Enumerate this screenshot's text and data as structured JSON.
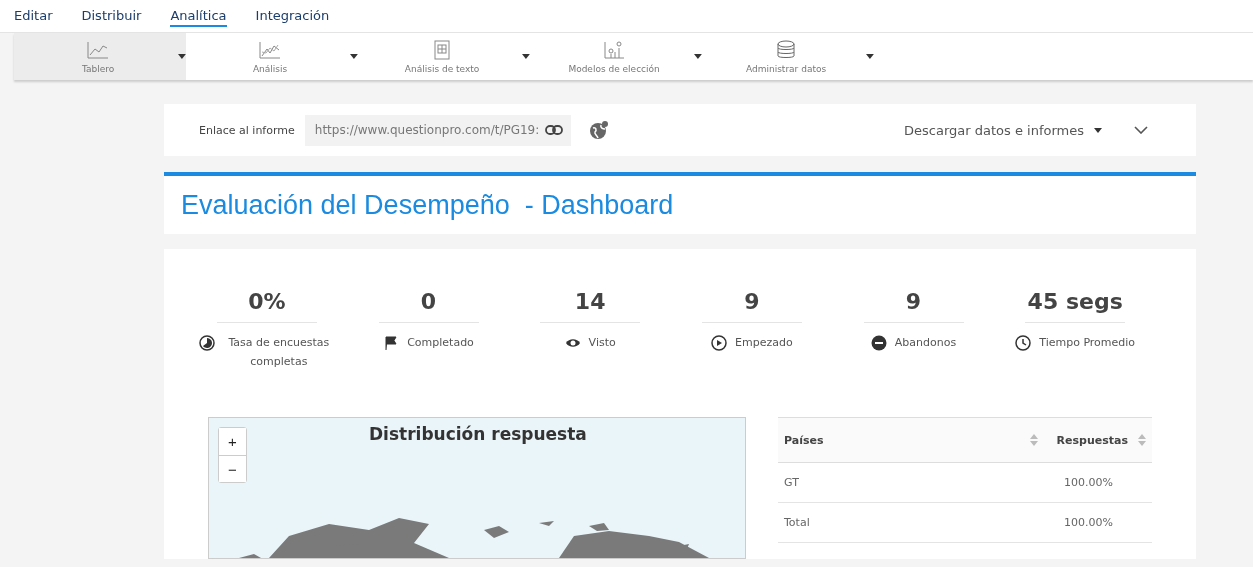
{
  "nav": [
    {
      "label": "Editar",
      "selected": false
    },
    {
      "label": "Distribuir",
      "selected": false
    },
    {
      "label": "Analítica",
      "selected": true
    },
    {
      "label": "Integración",
      "selected": false
    }
  ],
  "toolbar": [
    {
      "label": "Tablero",
      "selected": true
    },
    {
      "label": "Análisis",
      "selected": false
    },
    {
      "label": "Análisis de texto",
      "selected": false
    },
    {
      "label": "Modelos de elección",
      "selected": false
    },
    {
      "label": "Administrar datos",
      "selected": false
    }
  ],
  "report_link": {
    "label": "Enlace al informe",
    "value": "https://www.questionpro.com/t/PG19:"
  },
  "download": {
    "label": "Descargar datos e informes"
  },
  "title": "Evaluación del Desempeño  - Dashboard",
  "stats": [
    {
      "value": "0%",
      "label": "Tasa de encuestas completas"
    },
    {
      "value": "0",
      "label": "Completado"
    },
    {
      "value": "14",
      "label": "Visto"
    },
    {
      "value": "9",
      "label": "Empezado"
    },
    {
      "value": "9",
      "label": "Abandonos"
    },
    {
      "value": "45 segs",
      "label": "Tiempo Promedio"
    }
  ],
  "map": {
    "title": "Distribución respuesta",
    "zoom_in": "+",
    "zoom_out": "−"
  },
  "table": {
    "columns": [
      "Países",
      "Respuestas"
    ],
    "rows": [
      [
        "GT",
        "100.00%"
      ],
      [
        "Total",
        "100.00%"
      ]
    ]
  }
}
